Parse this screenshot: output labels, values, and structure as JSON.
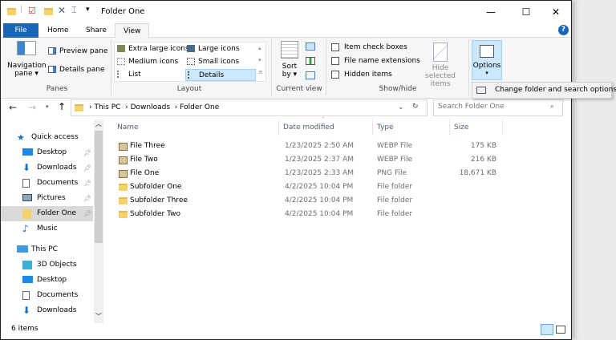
{
  "window": {
    "title": "Folder One",
    "controls": {
      "minimize": "—",
      "maximize": "☐",
      "close": "✕"
    }
  },
  "tabs": [
    {
      "label": "File"
    },
    {
      "label": "Home"
    },
    {
      "label": "Share"
    },
    {
      "label": "View"
    }
  ],
  "ribbon": {
    "panes": {
      "navigation_pane": "Navigation",
      "navigation_pane2": "pane ▾",
      "preview_pane": "Preview pane",
      "details_pane": "Details pane",
      "group": "Panes"
    },
    "layout": {
      "items": [
        "Extra large icons",
        "Large icons",
        "Medium icons",
        "Small icons",
        "List",
        "Details"
      ],
      "selected": "Details",
      "group": "Layout"
    },
    "current_view": {
      "sort": "Sort",
      "sort2": "by ▾",
      "group": "Current view"
    },
    "show_hide": {
      "checkboxes": [
        {
          "label": "Item check boxes",
          "checked": false
        },
        {
          "label": "File name extensions",
          "checked": false
        },
        {
          "label": "Hidden items",
          "checked": false
        }
      ],
      "hide_selected": "Hide selected",
      "hide_selected2": "items",
      "group": "Show/hide"
    },
    "options": {
      "label": "Options",
      "tooltip": "Change folder and search options"
    }
  },
  "address": {
    "path": [
      "This PC",
      "Downloads",
      "Folder One"
    ],
    "search_placeholder": "Search Folder One"
  },
  "nav": {
    "items": [
      {
        "label": "Quick access",
        "icon": "star-icon",
        "pinned": false,
        "selected": false
      },
      {
        "label": "Desktop",
        "icon": "desktop-icon",
        "pinned": true
      },
      {
        "label": "Downloads",
        "icon": "download-icon",
        "pinned": true
      },
      {
        "label": "Documents",
        "icon": "document-icon",
        "pinned": true
      },
      {
        "label": "Pictures",
        "icon": "pictures-icon",
        "pinned": true
      },
      {
        "label": "Folder One",
        "icon": "folder-icon",
        "pinned": true,
        "selected": true
      },
      {
        "label": "Music",
        "icon": "music-icon",
        "pinned": false
      },
      {
        "label": "This PC",
        "icon": "computer-icon",
        "pinned": false
      },
      {
        "label": "3D Objects",
        "icon": "cube-icon",
        "pinned": false
      },
      {
        "label": "Desktop",
        "icon": "desktop-icon",
        "pinned": false
      },
      {
        "label": "Documents",
        "icon": "document-icon",
        "pinned": false
      },
      {
        "label": "Downloads",
        "icon": "download-icon",
        "pinned": false
      }
    ]
  },
  "columns": [
    "Name",
    "Date modified",
    "Type",
    "Size"
  ],
  "files": [
    {
      "name": "File Three",
      "date": "1/23/2025 2:50 AM",
      "type": "WEBP File",
      "size": "175 KB",
      "icon": "image-icon"
    },
    {
      "name": "File Two",
      "date": "1/23/2025 2:37 AM",
      "type": "WEBP File",
      "size": "216 KB",
      "icon": "image-icon"
    },
    {
      "name": "File One",
      "date": "1/23/2025 2:33 AM",
      "type": "PNG File",
      "size": "18,671 KB",
      "icon": "image-icon"
    },
    {
      "name": "Subfolder One",
      "date": "4/2/2025 10:04 PM",
      "type": "File folder",
      "size": "",
      "icon": "folder-icon"
    },
    {
      "name": "Subfolder Three",
      "date": "4/2/2025 10:04 PM",
      "type": "File folder",
      "size": "",
      "icon": "folder-icon"
    },
    {
      "name": "Subfolder Two",
      "date": "4/2/2025 10:04 PM",
      "type": "File folder",
      "size": "",
      "icon": "folder-icon"
    }
  ],
  "status": {
    "count": "6 items"
  },
  "colors": {
    "file_tab": "#1966b7",
    "selection": "#cce8ff",
    "nav_selected": "#d9d9d9",
    "accent": "#0063b1"
  }
}
